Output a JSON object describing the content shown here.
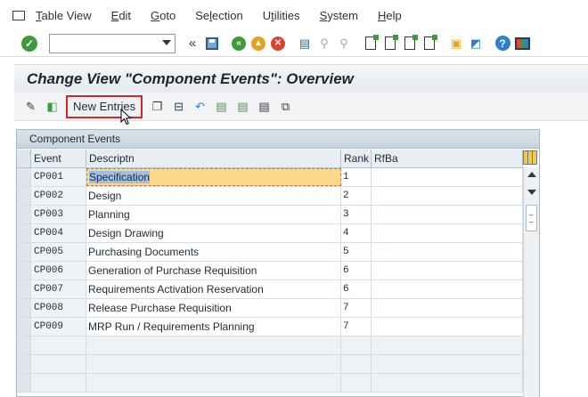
{
  "menu": {
    "items": [
      {
        "label": "Table View",
        "mnemonic": "T"
      },
      {
        "label": "Edit",
        "mnemonic": "E"
      },
      {
        "label": "Goto",
        "mnemonic": "G"
      },
      {
        "label": "Selection",
        "mnemonic": "l"
      },
      {
        "label": "Utilities",
        "mnemonic": "t"
      },
      {
        "label": "System",
        "mnemonic": "S"
      },
      {
        "label": "Help",
        "mnemonic": "H"
      }
    ]
  },
  "toolbar": {
    "command_value": "",
    "icons": [
      "check-icon",
      "save-icon",
      "back-icon",
      "exit-icon",
      "cancel-icon",
      "print-icon",
      "find-icon",
      "find-next-icon",
      "first-page-icon",
      "previous-page-icon",
      "next-page-icon",
      "last-page-icon",
      "new-session-icon",
      "shortcut-icon",
      "help-icon",
      "layout-icon"
    ]
  },
  "title": "Change View \"Component Events\": Overview",
  "app_toolbar": {
    "new_entries_label": "New Entries"
  },
  "table": {
    "title": "Component Events",
    "columns": [
      "Event",
      "Descriptn",
      "Rank",
      "RfBa"
    ],
    "rows": [
      {
        "event": "CP001",
        "description": "Specification",
        "rank": "1",
        "rfba": ""
      },
      {
        "event": "CP002",
        "description": "Design",
        "rank": "2",
        "rfba": ""
      },
      {
        "event": "CP003",
        "description": "Planning",
        "rank": "3",
        "rfba": ""
      },
      {
        "event": "CP004",
        "description": "Design Drawing",
        "rank": "4",
        "rfba": ""
      },
      {
        "event": "CP005",
        "description": "Purchasing Documents",
        "rank": "5",
        "rfba": ""
      },
      {
        "event": "CP006",
        "description": "Generation of Purchase Requisition",
        "rank": "6",
        "rfba": ""
      },
      {
        "event": "CP007",
        "description": "Requirements Activation Reservation",
        "rank": "6",
        "rfba": ""
      },
      {
        "event": "CP008",
        "description": "Release Purchase Requisition",
        "rank": "7",
        "rfba": ""
      },
      {
        "event": "CP009",
        "description": "MRP Run / Requirements Planning",
        "rank": "7",
        "rfba": ""
      }
    ]
  }
}
